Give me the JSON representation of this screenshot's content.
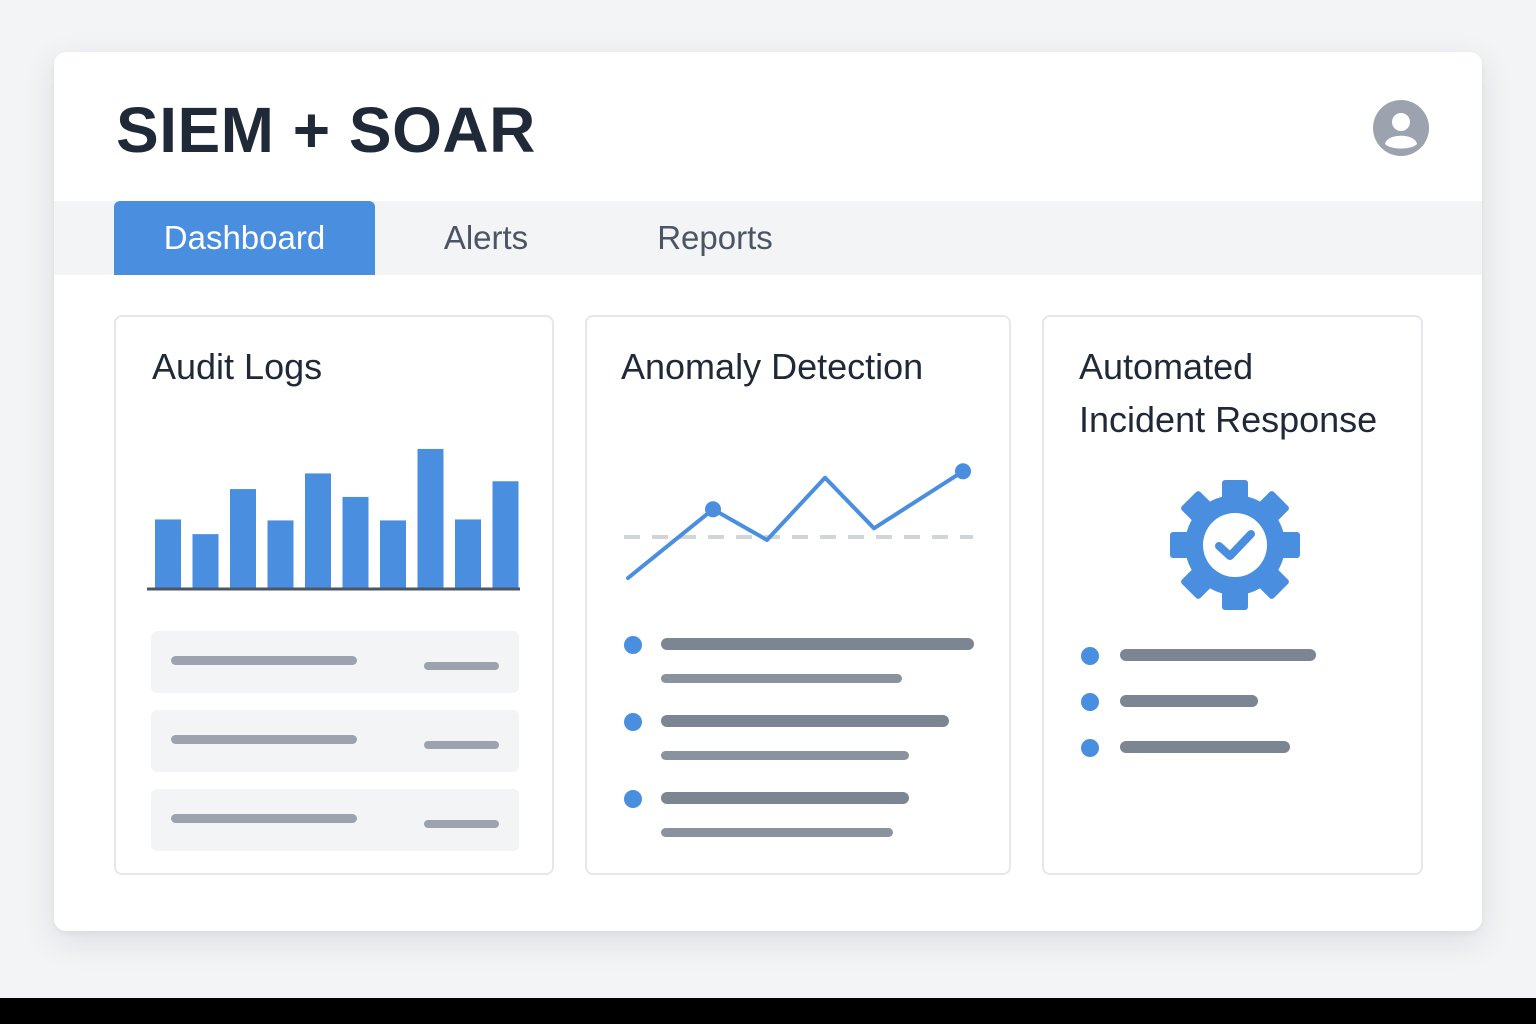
{
  "app": {
    "title": "SIEM + SOAR"
  },
  "tabs": [
    {
      "label": "Dashboard",
      "active": true
    },
    {
      "label": "Alerts",
      "active": false
    },
    {
      "label": "Reports",
      "active": false
    }
  ],
  "cards": {
    "audit_logs": {
      "title": "Audit Logs",
      "row_count": 3
    },
    "anomaly_detection": {
      "title": "Anomaly Detection",
      "item_count": 3
    },
    "incident_response": {
      "title_line1": "Automated",
      "title_line2": "Incident Response",
      "icon": "gear-check-icon",
      "item_count": 3
    }
  },
  "chart_data": [
    {
      "type": "bar",
      "values": [
        70,
        55,
        101,
        69,
        117,
        93,
        69,
        142,
        70,
        109
      ],
      "ylim": [
        0,
        145
      ],
      "grid": false
    },
    {
      "type": "line",
      "values": [
        10,
        86,
        52,
        121,
        65,
        128
      ],
      "markers": [
        1,
        5
      ],
      "baseline": 60,
      "ylim": [
        0,
        135
      ],
      "grid": false
    }
  ],
  "colors": {
    "accent": "#4a8ee0",
    "title_text": "#1f2937",
    "tab_text": "#4b5563",
    "placeholder_line": "#9ca3af",
    "placeholder_dark": "#7c8592",
    "baseline_dash": "#d1d5db"
  }
}
